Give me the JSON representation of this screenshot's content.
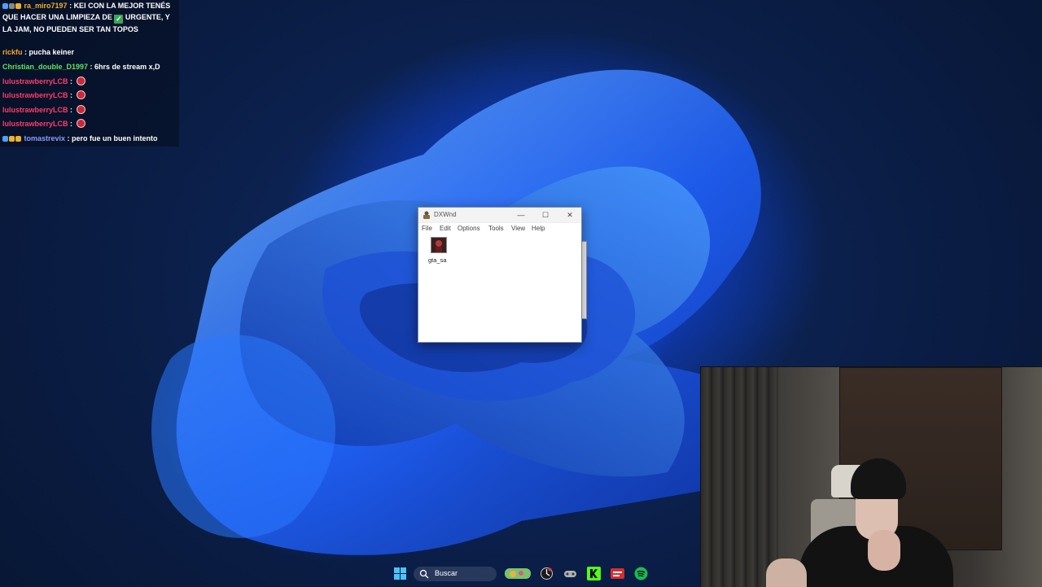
{
  "chat": {
    "messages": [
      {
        "user": "ra_miro7197",
        "user_color": "#f0b02a",
        "text": "KEI CON LA MEJOR TENÉS QUE HACER UNA LIMPIEZA DE",
        "text2": "URGENTE, Y LA JAM, NO PUEDEN SER TAN TOPOS",
        "emote": "check-mark-emote"
      },
      {
        "user": "rickfu",
        "user_color": "#f5a623",
        "text": "pucha keiner"
      },
      {
        "user": "Christian_double_D1997",
        "user_color": "#5fe35f",
        "text": "6hrs de stream x,D"
      },
      {
        "user": "lulustrawberryLCB",
        "user_color": "#ff3b6b",
        "text": "",
        "emote": "strawberry-emote"
      },
      {
        "user": "lulustrawberryLCB",
        "user_color": "#ff3b6b",
        "text": "",
        "emote": "strawberry-emote"
      },
      {
        "user": "lulustrawberryLCB",
        "user_color": "#ff3b6b",
        "text": "",
        "emote": "strawberry-emote"
      },
      {
        "user": "lulustrawberryLCB",
        "user_color": "#ff3b6b",
        "text": "",
        "emote": "strawberry-emote"
      },
      {
        "user": "tomastrevix",
        "user_color": "#8f9bff",
        "text": "pero fue un buen intento"
      }
    ],
    "separator": " : "
  },
  "dxwnd": {
    "title": "DXWnd",
    "controls": {
      "minimize": "—",
      "maximize": "☐",
      "close": "✕"
    },
    "menu": [
      "File",
      "Edit",
      "Options",
      "Tools",
      "View",
      "Help"
    ],
    "entries": [
      {
        "label": "gta_sa",
        "icon": "game-icon"
      }
    ]
  },
  "taskbar": {
    "search_placeholder": "Buscar",
    "icons": [
      "start-icon",
      "search-icon",
      "widgets-icon",
      "app-icon",
      "game-controller-icon",
      "kick-icon",
      "app-red-icon",
      "spotify-icon"
    ]
  },
  "colors": {
    "accent": "#1e6bff",
    "kick": "#53fc18",
    "spotify": "#1db954"
  }
}
